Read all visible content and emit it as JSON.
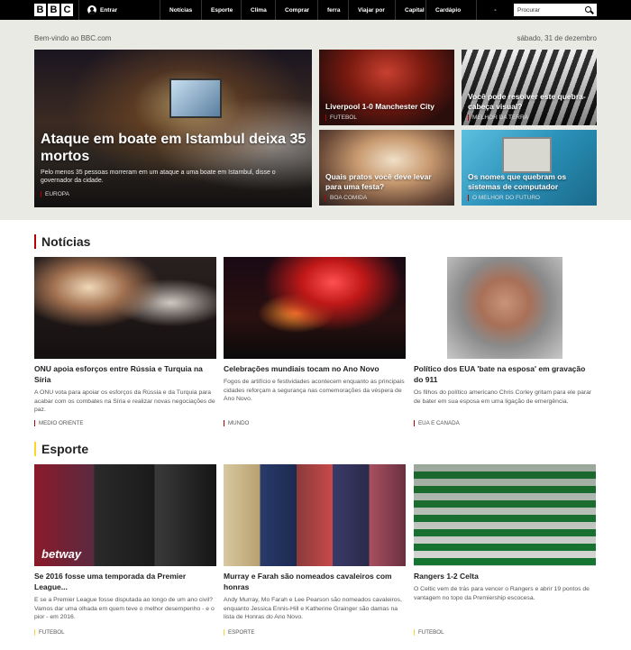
{
  "nav": {
    "logo": [
      "B",
      "B",
      "C"
    ],
    "signin_label": "Entrar",
    "items": [
      "Notícias",
      "Esporte",
      "Clima",
      "Comprar",
      "ferra",
      "Viajar por",
      "Capital",
      "Cardápio",
      "-"
    ],
    "search_placeholder": "Procurar"
  },
  "hero": {
    "welcome": "Bem-vindo ao BBC.com",
    "date": "sábado, 31 de dezembro",
    "main": {
      "headline": "Ataque em boate em Istambul deixa 35 mortos",
      "summary": "Pelo menos 35 pessoas morreram em um ataque a uma boate em Istambul, disse o governador da cidade.",
      "tag": "EUROPA"
    },
    "cards": [
      {
        "headline": "Liverpool 1-0 Manchester City",
        "tag": "FUTEBOL"
      },
      {
        "headline": "Você pode resolver este quebra-cabeça visual?",
        "tag": "MELHOR DA TERRA"
      },
      {
        "headline": "Quais pratos você deve levar para uma festa?",
        "tag": "BOA COMIDA"
      },
      {
        "headline": "Os nomes que quebram os sistemas de computador",
        "tag": "O MELHOR DO FUTURO"
      }
    ]
  },
  "news": {
    "title": "Notícias",
    "stories": [
      {
        "title": "ONU apoia esforços entre Rússia e Turquia na Síria",
        "summary": "A ONU vota para apoiar os esforços da Rússia e da Turquia para acabar com os combates na Síria e realizar novas negociações de paz.",
        "tag": "MEDIO ORIENTE"
      },
      {
        "title": "Celebrações mundiais tocam no Ano Novo",
        "summary": "Fogos de artifício e festividades acontecem enquanto as principais cidades reforçam a segurança nas comemorações da véspera de Ano Novo.",
        "tag": "MUNDO"
      },
      {
        "title": "Político dos EUA 'bate na esposa' em gravação do 911",
        "summary": "Os filhos do político americano Chris Corley gritam para ele parar de bater em sua esposa em uma ligação de emergência.",
        "tag": "EUA E CANADÁ"
      }
    ]
  },
  "sport": {
    "title": "Esporte",
    "stories": [
      {
        "title": "Se 2016 fosse uma temporada da Premier League...",
        "summary": "E se a Premier League fosse disputada ao longo de um ano civil? Vamos dar uma olhada em quem teve o melhor desempenho - e o pior - em 2016.",
        "tag": "FUTEBOL",
        "image_text": "betway"
      },
      {
        "title": "Murray e Farah são nomeados cavaleiros com honras",
        "summary": "Andy Murray, Mo Farah e Lee Pearson são nomeados cavaleiros, enquanto Jessica Ennis-Hill e Katherine Grainger são damas na lista de Honras do Ano Novo.",
        "tag": "ESPORTE"
      },
      {
        "title": "Rangers 1-2 Celta",
        "summary": "O Celtic vem de trás para vencer o Rangers e abrir 19 pontos de vantagem no topo da Premiership escocesa.",
        "tag": "FUTEBOL"
      }
    ]
  }
}
